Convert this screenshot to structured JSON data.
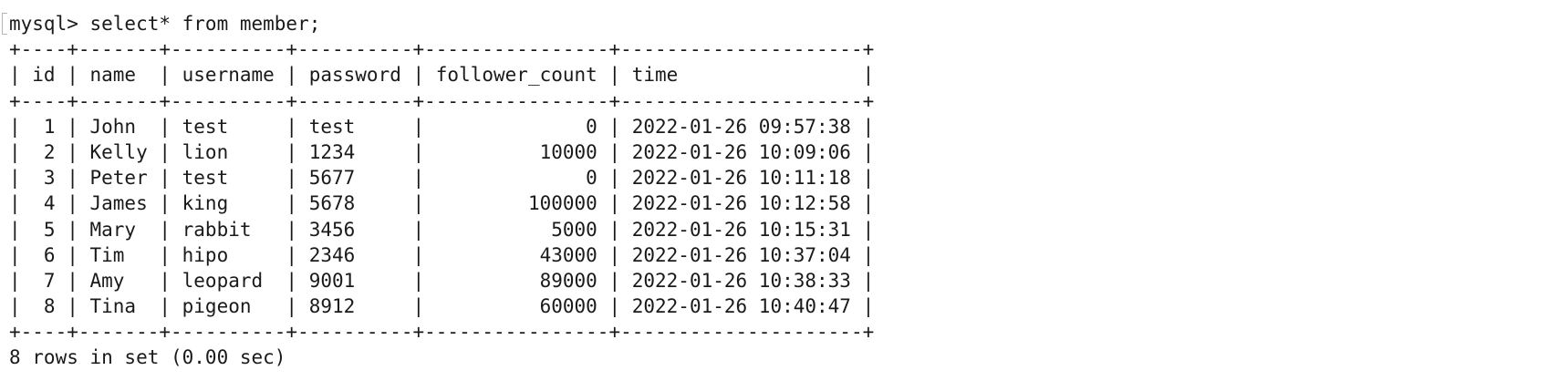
{
  "terminal": {
    "prompt": "mysql> select* from member;",
    "table": {
      "top_border": "+----+-------+----------+----------+----------------+---------------------+",
      "header": "| id | name  | username | password | follower_count | time                |",
      "header_border": "+----+-------+----------+----------+----------------+---------------------+",
      "rows": [
        "|  1 | John  | test     | test     |              0 | 2022-01-26 09:57:38 |",
        "|  2 | Kelly | lion     | 1234     |          10000 | 2022-01-26 10:09:06 |",
        "|  3 | Peter | test     | 5677     |              0 | 2022-01-26 10:11:18 |",
        "|  4 | James | king     | 5678     |         100000 | 2022-01-26 10:12:58 |",
        "|  5 | Mary  | rabbit   | 3456     |           5000 | 2022-01-26 10:15:31 |",
        "|  6 | Tim   | hipo     | 2346     |          43000 | 2022-01-26 10:37:04 |",
        "|  7 | Amy   | leopard  | 9001     |          89000 | 2022-01-26 10:38:33 |",
        "|  8 | Tina  | pigeon   | 8912     |          60000 | 2022-01-26 10:40:47 |"
      ],
      "bottom_border": "+----+-------+----------+----------+----------------+---------------------+"
    },
    "summary": "8 rows in set (0.00 sec)"
  }
}
